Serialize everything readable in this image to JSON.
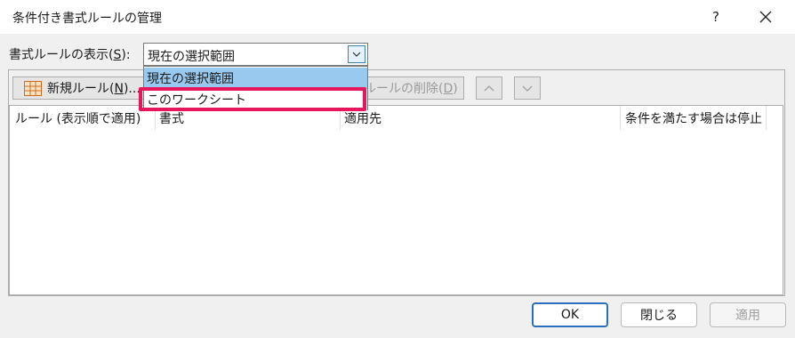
{
  "window": {
    "title": "条件付き書式ルールの管理",
    "help_label": "?"
  },
  "display": {
    "label": "書式ルールの表示(",
    "accel": "S",
    "label_end": "):",
    "selected": "現在の選択範囲"
  },
  "dropdown": {
    "options": [
      "現在の選択範囲",
      "このワークシート"
    ],
    "highlighted": "このワークシート"
  },
  "toolbar": {
    "new_rule_label": "新規ルール(",
    "new_rule_accel": "N",
    "new_rule_end": ")...",
    "delete_rule_label": "ルールの削除(",
    "delete_rule_accel": "D",
    "delete_rule_end": ")"
  },
  "list": {
    "columns": [
      "ルール (表示順で適用)",
      "書式",
      "適用先",
      "条件を満たす場合は停止"
    ],
    "rows": []
  },
  "buttons": {
    "ok": "OK",
    "close": "閉じる",
    "apply": "適用"
  },
  "colors": {
    "highlight": "#e8175d",
    "selection": "#99c9ef",
    "focus_border": "#2a6fbe"
  }
}
